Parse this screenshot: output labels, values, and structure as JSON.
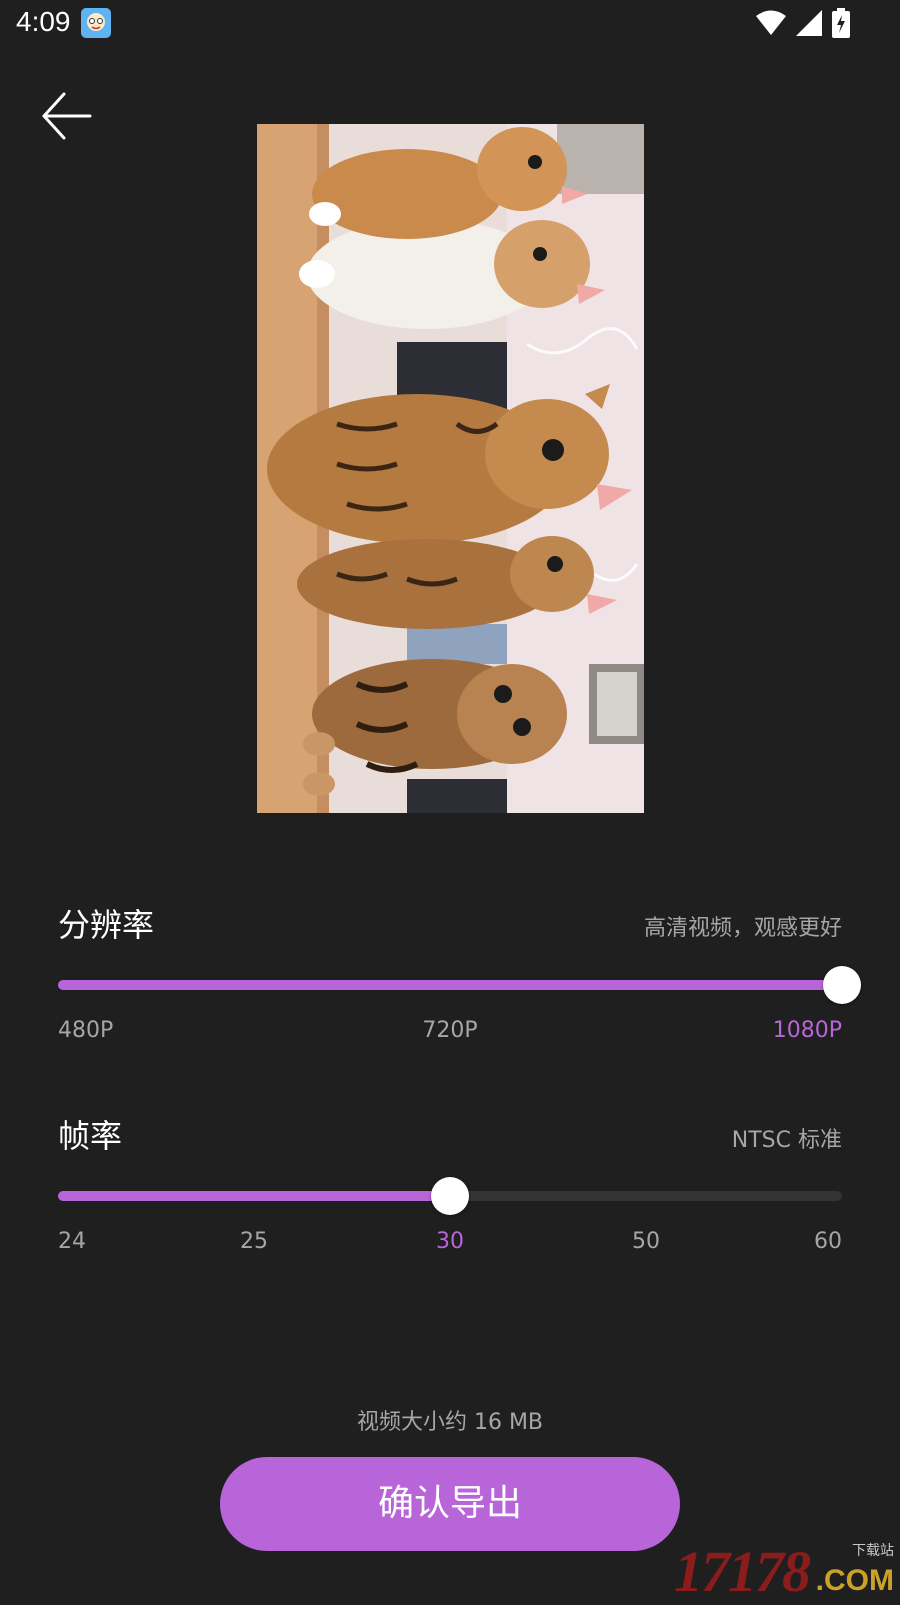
{
  "status_bar": {
    "time": "4:09",
    "icons": [
      "app-notification-icon",
      "wifi-icon",
      "signal-icon",
      "battery-charging-icon"
    ]
  },
  "header": {
    "back_icon": "arrow-left-icon"
  },
  "preview": {
    "content": "video-thumbnail-kittens"
  },
  "resolution": {
    "title": "分辨率",
    "hint": "高清视频，观感更好",
    "options": [
      "480P",
      "720P",
      "1080P"
    ],
    "selected": "1080P",
    "fill_fraction": 1.0
  },
  "frame_rate": {
    "title": "帧率",
    "hint": "NTSC 标准",
    "options": [
      "24",
      "25",
      "30",
      "50",
      "60"
    ],
    "selected": "30",
    "fill_fraction": 0.5
  },
  "footer": {
    "size_text": "视频大小约 16 MB",
    "export_label": "确认导出"
  },
  "watermark": {
    "number": "17178",
    "small_text": "下载站",
    "domain": ".COM"
  },
  "colors": {
    "background": "#1f1f1f",
    "accent": "#b865d9",
    "muted_text": "#a6a6a6",
    "track": "#333333"
  }
}
